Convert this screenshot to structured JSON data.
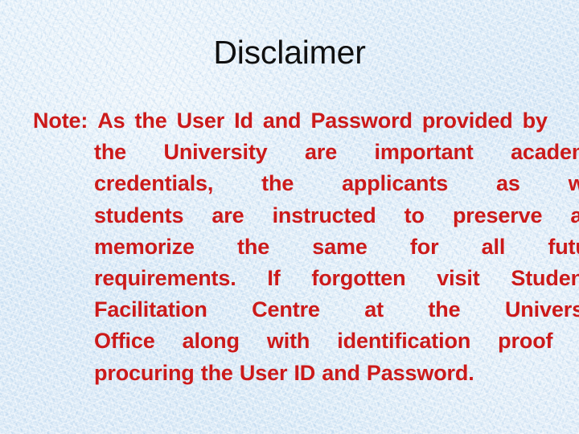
{
  "slide": {
    "title": "Disclaimer",
    "title_color": "#101010",
    "background_color": "#dcebf8",
    "body_color": "#cc1a1a",
    "body_lines": [
      {
        "text": "Note: As the User Id and Password provided by",
        "indented": false,
        "justified": true
      },
      {
        "text": "the University are important academic",
        "indented": true,
        "justified": true
      },
      {
        "text": "credentials, the applicants as well",
        "indented": true,
        "justified": true
      },
      {
        "text": "students are instructed to preserve and",
        "indented": true,
        "justified": true
      },
      {
        "text": "memorize the same for all future",
        "indented": true,
        "justified": true
      },
      {
        "text": "requirements. If forgotten visit Students’",
        "indented": true,
        "justified": true
      },
      {
        "text": "Facilitation Centre at the University",
        "indented": true,
        "justified": true
      },
      {
        "text": "Office along with identification proof for",
        "indented": true,
        "justified": true
      },
      {
        "text": "procuring the User ID and Password.",
        "indented": true,
        "justified": false
      }
    ],
    "body_full_text": "Note: As the User Id and Password provided by the University are important academic credentials, the applicants as well students are instructed to preserve and memorize the same for all future requirements. If forgotten visit Students’ Facilitation Centre at the University Office along with identification proof for procuring the User ID and Password."
  }
}
